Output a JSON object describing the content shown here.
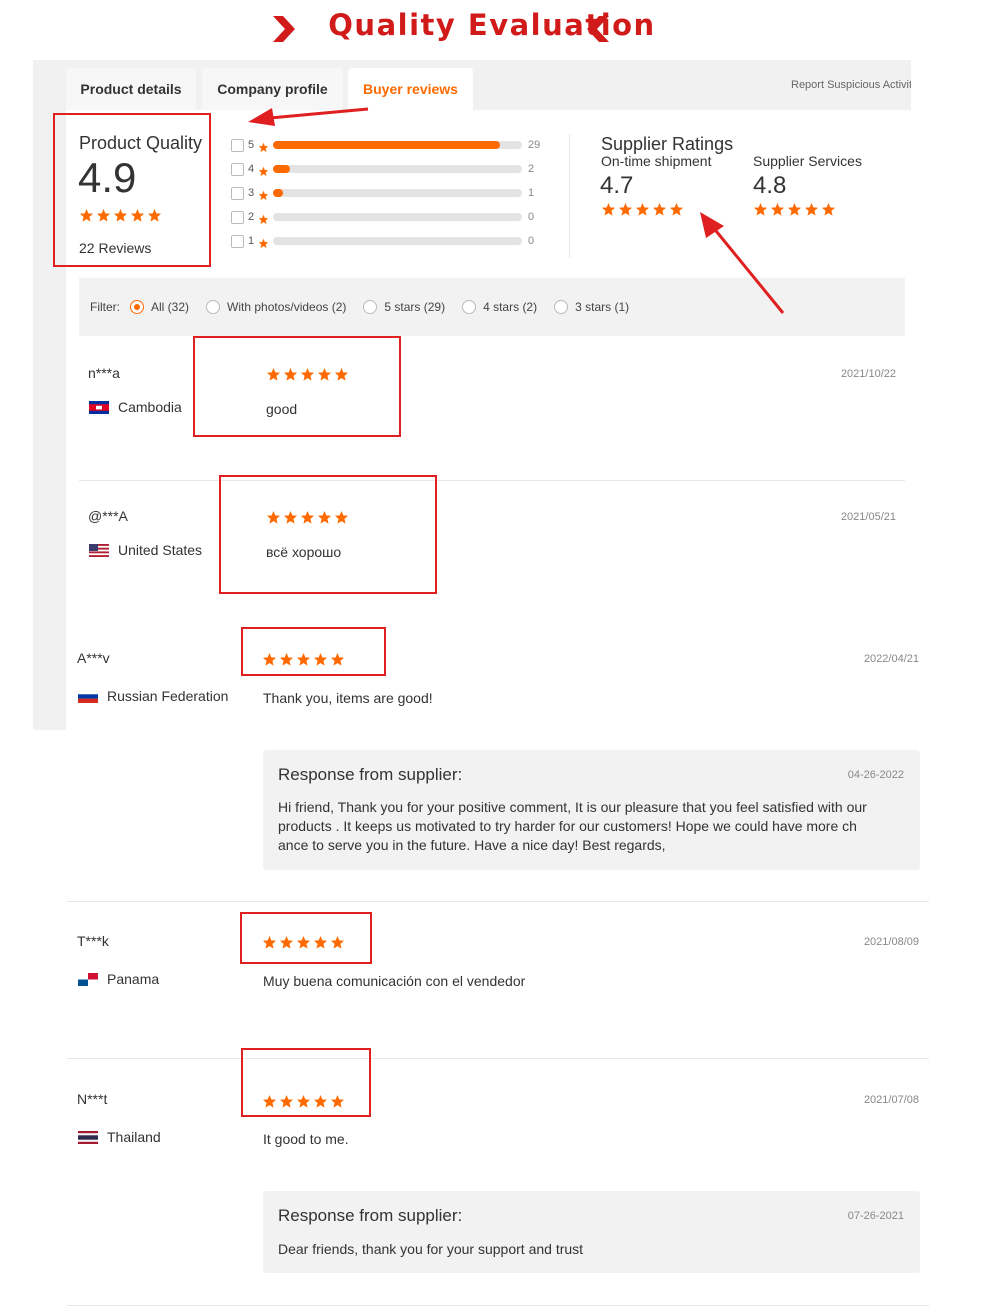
{
  "banner": {
    "title": "Quality Evaluation"
  },
  "tabs": [
    {
      "label": "Product details"
    },
    {
      "label": "Company profile"
    },
    {
      "label": "Buyer reviews"
    }
  ],
  "report_link": "Report Suspicious Activity",
  "product_quality": {
    "label": "Product Quality",
    "score": "4.9",
    "stars": 5,
    "reviews_label": "22 Reviews"
  },
  "rating_bars": [
    {
      "stars": "5",
      "count": "29",
      "fraction": 0.91
    },
    {
      "stars": "4",
      "count": "2",
      "fraction": 0.07
    },
    {
      "stars": "3",
      "count": "1",
      "fraction": 0.03
    },
    {
      "stars": "2",
      "count": "0",
      "fraction": 0
    },
    {
      "stars": "1",
      "count": "0",
      "fraction": 0
    }
  ],
  "supplier_ratings": {
    "title": "Supplier Ratings",
    "shipment": {
      "label": "On-time shipment",
      "score": "4.7",
      "stars": 5
    },
    "services": {
      "label": "Supplier Services",
      "score": "4.8",
      "stars": 5
    }
  },
  "filter": {
    "label": "Filter:",
    "options": [
      {
        "label": "All (32)",
        "selected": true
      },
      {
        "label": "With photos/videos (2)",
        "selected": false
      },
      {
        "label": "5 stars (29)",
        "selected": false
      },
      {
        "label": "4 stars (2)",
        "selected": false
      },
      {
        "label": "3 stars (1)",
        "selected": false
      }
    ]
  },
  "reviews": [
    {
      "user": "n***a",
      "country": "Cambodia",
      "flag": "cambodia-flag-icon",
      "date": "2021/10/22",
      "text": "good",
      "stars": 5
    },
    {
      "user": "@***A",
      "country": "United States",
      "flag": "us-flag-icon",
      "date": "2021/05/21",
      "text": "всё хорошо",
      "stars": 5
    },
    {
      "user": "A***v",
      "country": "Russian Federation",
      "flag": "russia-flag-icon",
      "date": "2022/04/21",
      "text": "Thank you, items are good!",
      "stars": 5,
      "response": {
        "title": "Response from supplier:",
        "date": "04-26-2022",
        "lines": [
          "Hi friend, Thank you for your positive comment, It is our pleasure that you feel satisfied with our",
          "products . It keeps us motivated to try harder for our customers! Hope we could have more ch",
          "ance to serve you in the future. Have a nice day! Best regards,"
        ]
      }
    },
    {
      "user": "T***k",
      "country": "Panama",
      "flag": "panama-flag-icon",
      "date": "2021/08/09",
      "text": "Muy buena comunicación con el vendedor",
      "stars": 5
    },
    {
      "user": "N***t",
      "country": "Thailand",
      "flag": "thailand-flag-icon",
      "date": "2021/07/08",
      "text": "It good to me.",
      "stars": 5,
      "response": {
        "title": "Response from supplier:",
        "date": "07-26-2021",
        "lines": [
          "Dear friends, thank you for your support and trust"
        ]
      }
    }
  ],
  "colors": {
    "accent": "#ff6a00",
    "annotation_red": "#e02020",
    "banner_red": "#d11b1b"
  }
}
